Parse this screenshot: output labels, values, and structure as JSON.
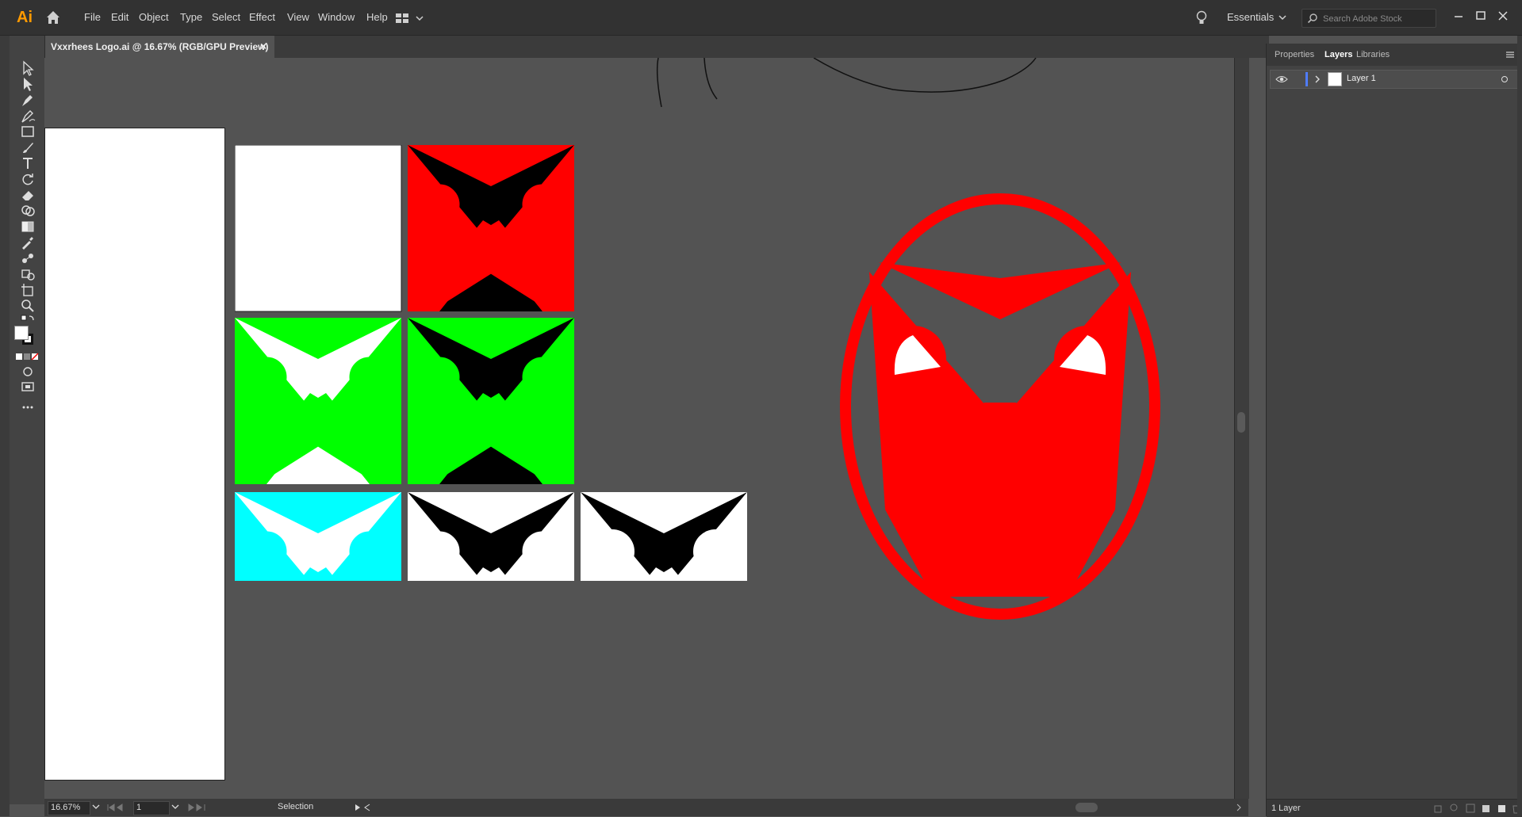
{
  "app": {
    "logo_text": "Ai",
    "menu": [
      "File",
      "Edit",
      "Object",
      "Type",
      "Select",
      "Effect",
      "View",
      "Window",
      "Help"
    ],
    "workspace": "Essentials",
    "search_placeholder": "Search Adobe Stock"
  },
  "document": {
    "tab_title": "Vxxrhees Logo.ai @ 16.67% (RGB/GPU Preview)",
    "close_glyph": "×"
  },
  "statusbar": {
    "zoom": "16.67%",
    "page": "1",
    "tool_status": "Selection"
  },
  "panel": {
    "tabs": [
      "Properties",
      "Layers",
      "Libraries"
    ],
    "active_tab": "Layers",
    "layers": [
      {
        "name": "Layer 1"
      }
    ],
    "layer_count": "1 Layer"
  },
  "artwork": {
    "colors": {
      "red": "#ff0000",
      "green": "#00ff00",
      "cyan": "#00ffff",
      "black": "#000000",
      "white": "#ffffff",
      "canvas": "#535353"
    },
    "logo_variants": [
      {
        "name": "blank",
        "bg": "#ffffff",
        "fg": null
      },
      {
        "name": "red-on-black",
        "bg": "#000000",
        "fg": "#ff0000"
      },
      {
        "name": "green-on-white",
        "bg": "#ffffff",
        "fg": "#00ff00"
      },
      {
        "name": "green-on-black",
        "bg": "#000000",
        "fg": "#00ff00"
      },
      {
        "name": "cyan-on-white",
        "bg": "#ffffff",
        "fg": "#00ffff"
      },
      {
        "name": "white-on-black",
        "bg": "#000000",
        "fg": "#ffffff"
      },
      {
        "name": "white-on-black-solid",
        "bg": "#000000",
        "fg": "#ffffff"
      }
    ]
  }
}
